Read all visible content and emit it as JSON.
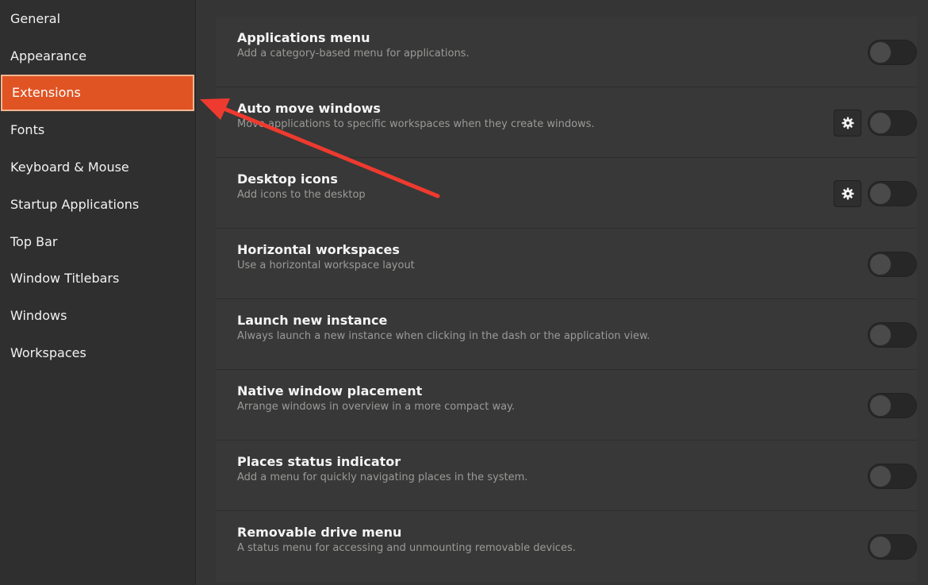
{
  "sidebar": {
    "items": [
      {
        "label": "General"
      },
      {
        "label": "Appearance"
      },
      {
        "label": "Extensions"
      },
      {
        "label": "Fonts"
      },
      {
        "label": "Keyboard & Mouse"
      },
      {
        "label": "Startup Applications"
      },
      {
        "label": "Top Bar"
      },
      {
        "label": "Window Titlebars"
      },
      {
        "label": "Windows"
      },
      {
        "label": "Workspaces"
      }
    ],
    "selected": "Extensions"
  },
  "extensions": [
    {
      "title": "Applications menu",
      "description": "Add a category-based menu for applications.",
      "enabled": false,
      "has_settings": false
    },
    {
      "title": "Auto move windows",
      "description": "Move applications to specific workspaces when they create windows.",
      "enabled": false,
      "has_settings": true
    },
    {
      "title": "Desktop icons",
      "description": "Add icons to the desktop",
      "enabled": false,
      "has_settings": true
    },
    {
      "title": "Horizontal workspaces",
      "description": "Use a horizontal workspace layout",
      "enabled": false,
      "has_settings": false
    },
    {
      "title": "Launch new instance",
      "description": "Always launch a new instance when clicking in the dash or the application view.",
      "enabled": false,
      "has_settings": false
    },
    {
      "title": "Native window placement",
      "description": "Arrange windows in overview in a more compact way.",
      "enabled": false,
      "has_settings": false
    },
    {
      "title": "Places status indicator",
      "description": "Add a menu for quickly navigating places in the system.",
      "enabled": false,
      "has_settings": false
    },
    {
      "title": "Removable drive menu",
      "description": "A status menu for accessing and unmounting removable devices.",
      "enabled": false,
      "has_settings": false
    }
  ],
  "colors": {
    "accent": "#e05424",
    "annotation_arrow": "#ee3a2f"
  }
}
